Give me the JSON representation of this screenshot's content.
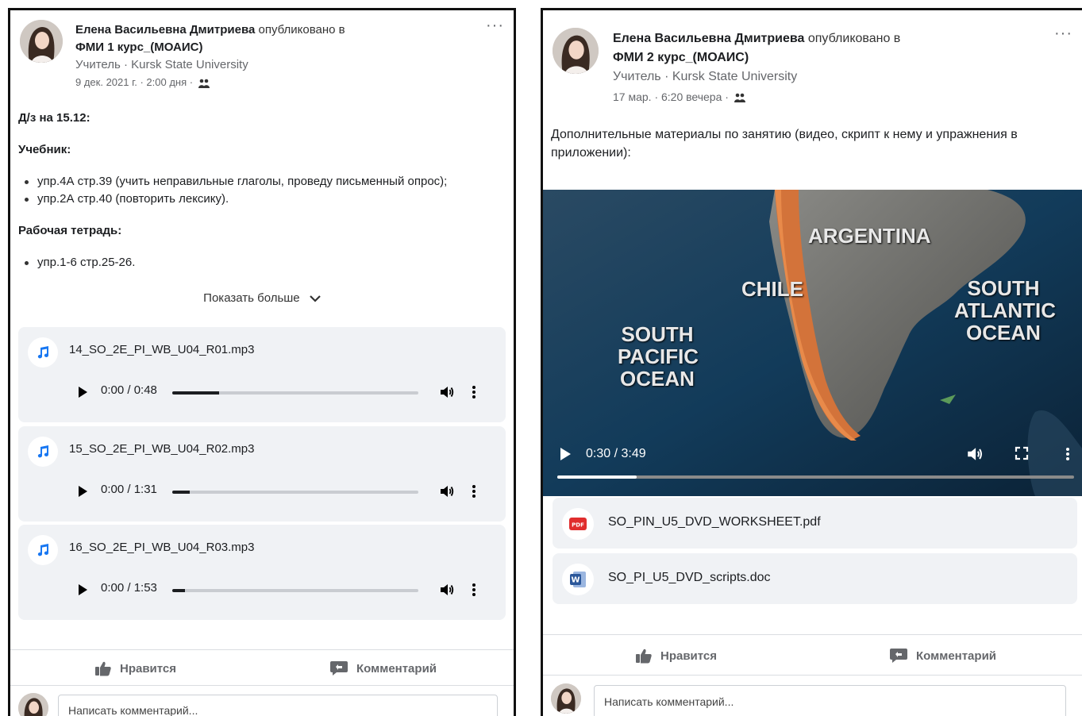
{
  "post_left": {
    "author": "Елена Васильевна Дмитриева",
    "published_in": "опубликовано в",
    "group": "ФМИ 1 курс_(МОАИС)",
    "role": "Учитель · Kursk State University",
    "date": "9 дек. 2021 г. · 2:00 дня ·",
    "more_icon": "ellipsis-icon",
    "lines": {
      "homework": "Д/з на 15.12:",
      "textbook": "Учебник:",
      "textbook_items": [
        "упр.4А стр.39 (учить неправильные глаголы, проведу письменный опрос);",
        "упр.2А стр.40 (повторить лексику)."
      ],
      "workbook": "Рабочая тетрадь:",
      "workbook_items": [
        "упр.1-6 стр.25-26."
      ]
    },
    "show_more": "Показать больше",
    "audio": [
      {
        "name": "14_SO_2E_PI_WB_U04_R01.mp3",
        "time": "0:00 / 0:48",
        "progress": 0.19
      },
      {
        "name": "15_SO_2E_PI_WB_U04_R02.mp3",
        "time": "0:00 / 1:31",
        "progress": 0.07
      },
      {
        "name": "16_SO_2E_PI_WB_U04_R03.mp3",
        "time": "0:00 / 1:53",
        "progress": 0.05
      }
    ],
    "like": "Нравится",
    "comment": "Комментарий",
    "comment_placeholder": "Написать комментарий..."
  },
  "post_right": {
    "author": "Елена Васильевна Дмитриева",
    "published_in": "опубликовано в",
    "group": "ФМИ 2 курс_(МОАИС)",
    "role": "Учитель · Kursk State University",
    "date": "17 мар. · 6:20 вечера ·",
    "text": "Дополнительные материалы по занятию (видео, скрипт к нему и упражнения в приложении):",
    "video": {
      "labels": {
        "argentina": "ARGENTINA",
        "chile": "CHILE",
        "south_pacific": "SOUTH PACIFIC OCEAN",
        "south_atlantic": "SOUTH ATLANTIC OCEAN"
      },
      "time": "0:30 / 3:49",
      "progress": 0.153
    },
    "attachments": [
      {
        "name": "SO_PIN_U5_DVD_WORKSHEET.pdf",
        "icon": "pdf-file-icon"
      },
      {
        "name": "SO_PI_U5_DVD_scripts.doc",
        "icon": "word-file-icon"
      }
    ],
    "like": "Нравится",
    "comment": "Комментарий",
    "comment_placeholder": "Написать комментарий..."
  },
  "colors": {
    "accent_blue": "#1877f2",
    "text": "#1c1e21",
    "muted": "#65676b",
    "card_bg": "#f0f2f5",
    "pdf_red": "#e02d2d",
    "word_blue": "#2b579a"
  }
}
